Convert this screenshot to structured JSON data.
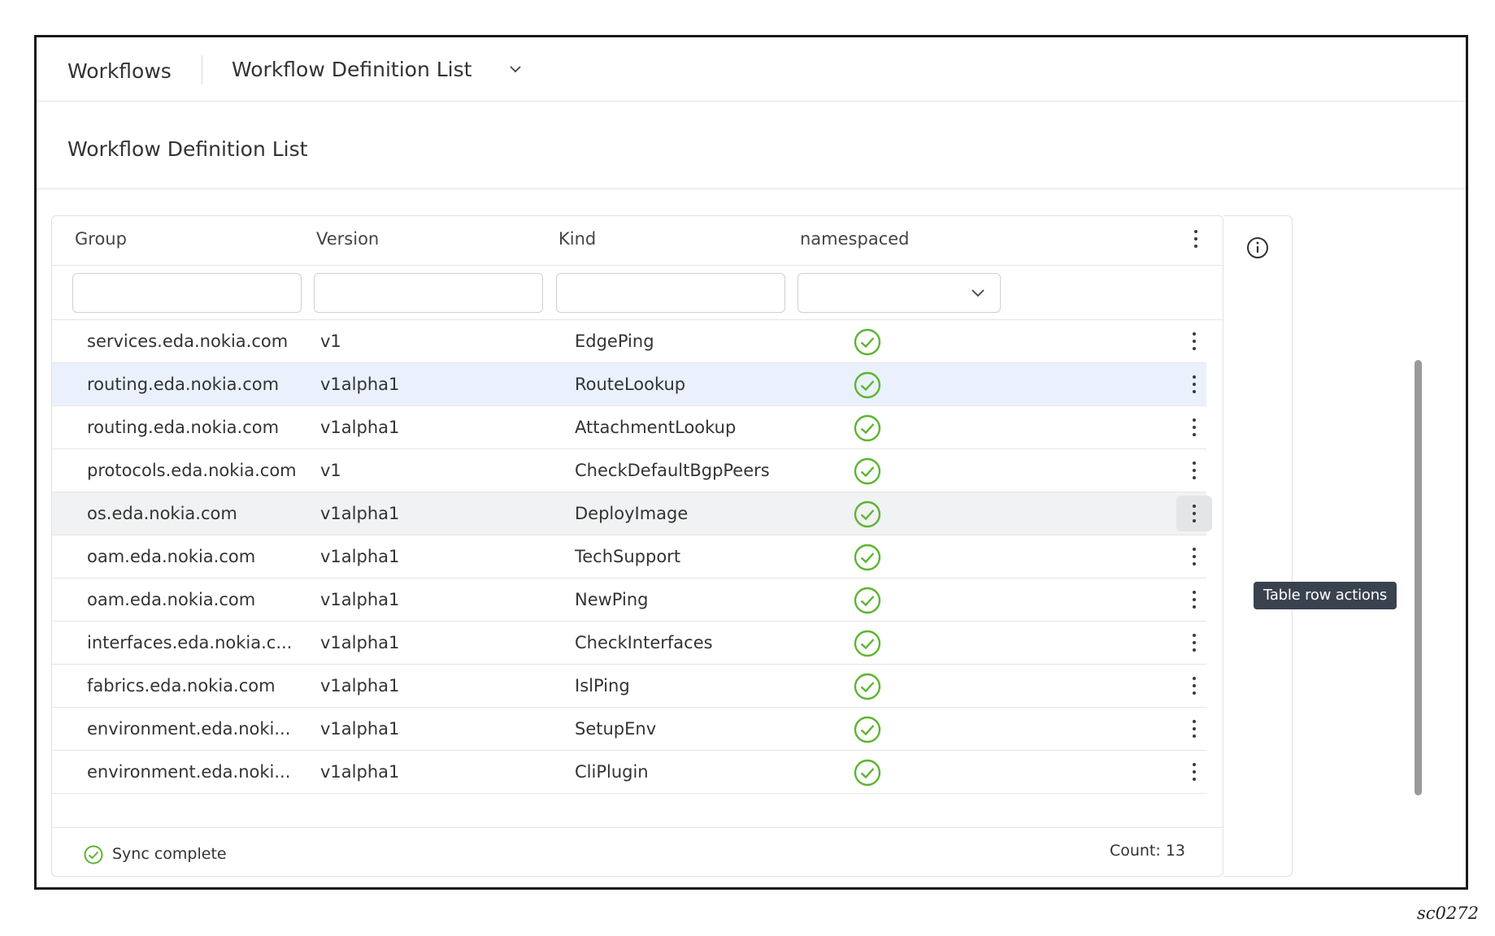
{
  "header": {
    "app_title": "Workflows",
    "view_selector": "Workflow Definition List"
  },
  "page": {
    "title": "Workflow Definition List"
  },
  "table": {
    "columns": [
      "Group",
      "Version",
      "Kind",
      "namespaced"
    ],
    "filters": {
      "group": "",
      "version": "",
      "kind": "",
      "namespaced": ""
    },
    "rows": [
      {
        "group": "services.eda.nokia.com",
        "version": "v1",
        "kind": "EdgePing",
        "namespaced": true
      },
      {
        "group": "routing.eda.nokia.com",
        "version": "v1alpha1",
        "kind": "RouteLookup",
        "namespaced": true
      },
      {
        "group": "routing.eda.nokia.com",
        "version": "v1alpha1",
        "kind": "AttachmentLookup",
        "namespaced": true
      },
      {
        "group": "protocols.eda.nokia.com",
        "version": "v1",
        "kind": "CheckDefaultBgpPeers",
        "namespaced": true
      },
      {
        "group": "os.eda.nokia.com",
        "version": "v1alpha1",
        "kind": "DeployImage",
        "namespaced": true
      },
      {
        "group": "oam.eda.nokia.com",
        "version": "v1alpha1",
        "kind": "TechSupport",
        "namespaced": true
      },
      {
        "group": "oam.eda.nokia.com",
        "version": "v1alpha1",
        "kind": "NewPing",
        "namespaced": true
      },
      {
        "group": "interfaces.eda.nokia.c...",
        "version": "v1alpha1",
        "kind": "CheckInterfaces",
        "namespaced": true
      },
      {
        "group": "fabrics.eda.nokia.com",
        "version": "v1alpha1",
        "kind": "IslPing",
        "namespaced": true
      },
      {
        "group": "environment.eda.noki...",
        "version": "v1alpha1",
        "kind": "SetupEnv",
        "namespaced": true
      },
      {
        "group": "environment.eda.noki...",
        "version": "v1alpha1",
        "kind": "CliPlugin",
        "namespaced": true
      }
    ],
    "selected_row": 1,
    "hover_row": 4,
    "tooltip": "Table row actions"
  },
  "footer": {
    "sync_status": "Sync complete",
    "count": "Count: 13"
  },
  "figure_id": "sc0272",
  "colors": {
    "accent_green": "#5cb531",
    "selected_row": "#eaf1fd",
    "tooltip_bg": "#39424e"
  }
}
